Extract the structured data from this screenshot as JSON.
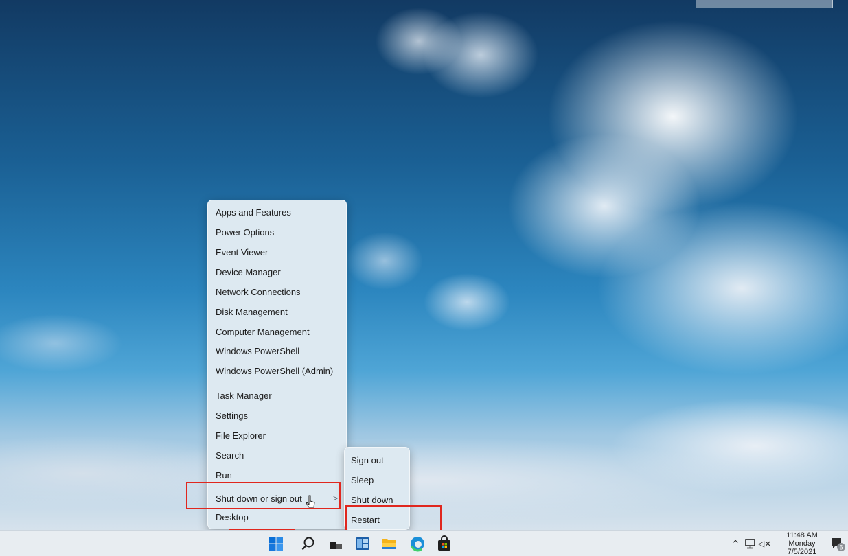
{
  "context_menu": {
    "items": [
      {
        "label": "Apps and Features"
      },
      {
        "label": "Power Options"
      },
      {
        "label": "Event Viewer"
      },
      {
        "label": "Device Manager"
      },
      {
        "label": "Network Connections"
      },
      {
        "label": "Disk Management"
      },
      {
        "label": "Computer Management"
      },
      {
        "label": "Windows PowerShell"
      },
      {
        "label": "Windows PowerShell (Admin)"
      },
      {
        "label": "Task Manager"
      },
      {
        "label": "Settings"
      },
      {
        "label": "File Explorer"
      },
      {
        "label": "Search"
      },
      {
        "label": "Run"
      },
      {
        "label": "Shut down or sign out",
        "submenu_indicator": ">"
      },
      {
        "label": "Desktop"
      }
    ]
  },
  "submenu": {
    "items": [
      {
        "label": "Sign out"
      },
      {
        "label": "Sleep"
      },
      {
        "label": "Shut down"
      },
      {
        "label": "Restart"
      }
    ]
  },
  "taskbar": {
    "icons": [
      "windows-start-icon",
      "search-icon",
      "task-view-icon",
      "widgets-icon",
      "file-explorer-icon",
      "edge-icon",
      "store-icon"
    ],
    "tray": {
      "chevron": "^",
      "network": "network-icon",
      "volume": "volume-muted-icon",
      "volume_glyph": "◁×"
    },
    "clock": {
      "time": "11:48 AM",
      "day": "Monday",
      "date": "7/5/2021"
    },
    "notification_badge": "6"
  },
  "colors": {
    "annotation": "#e0271e",
    "menu_bg": "#dde9f1",
    "taskbar_bg": "#e8edf1",
    "start_blue": "#0a6fd6"
  }
}
